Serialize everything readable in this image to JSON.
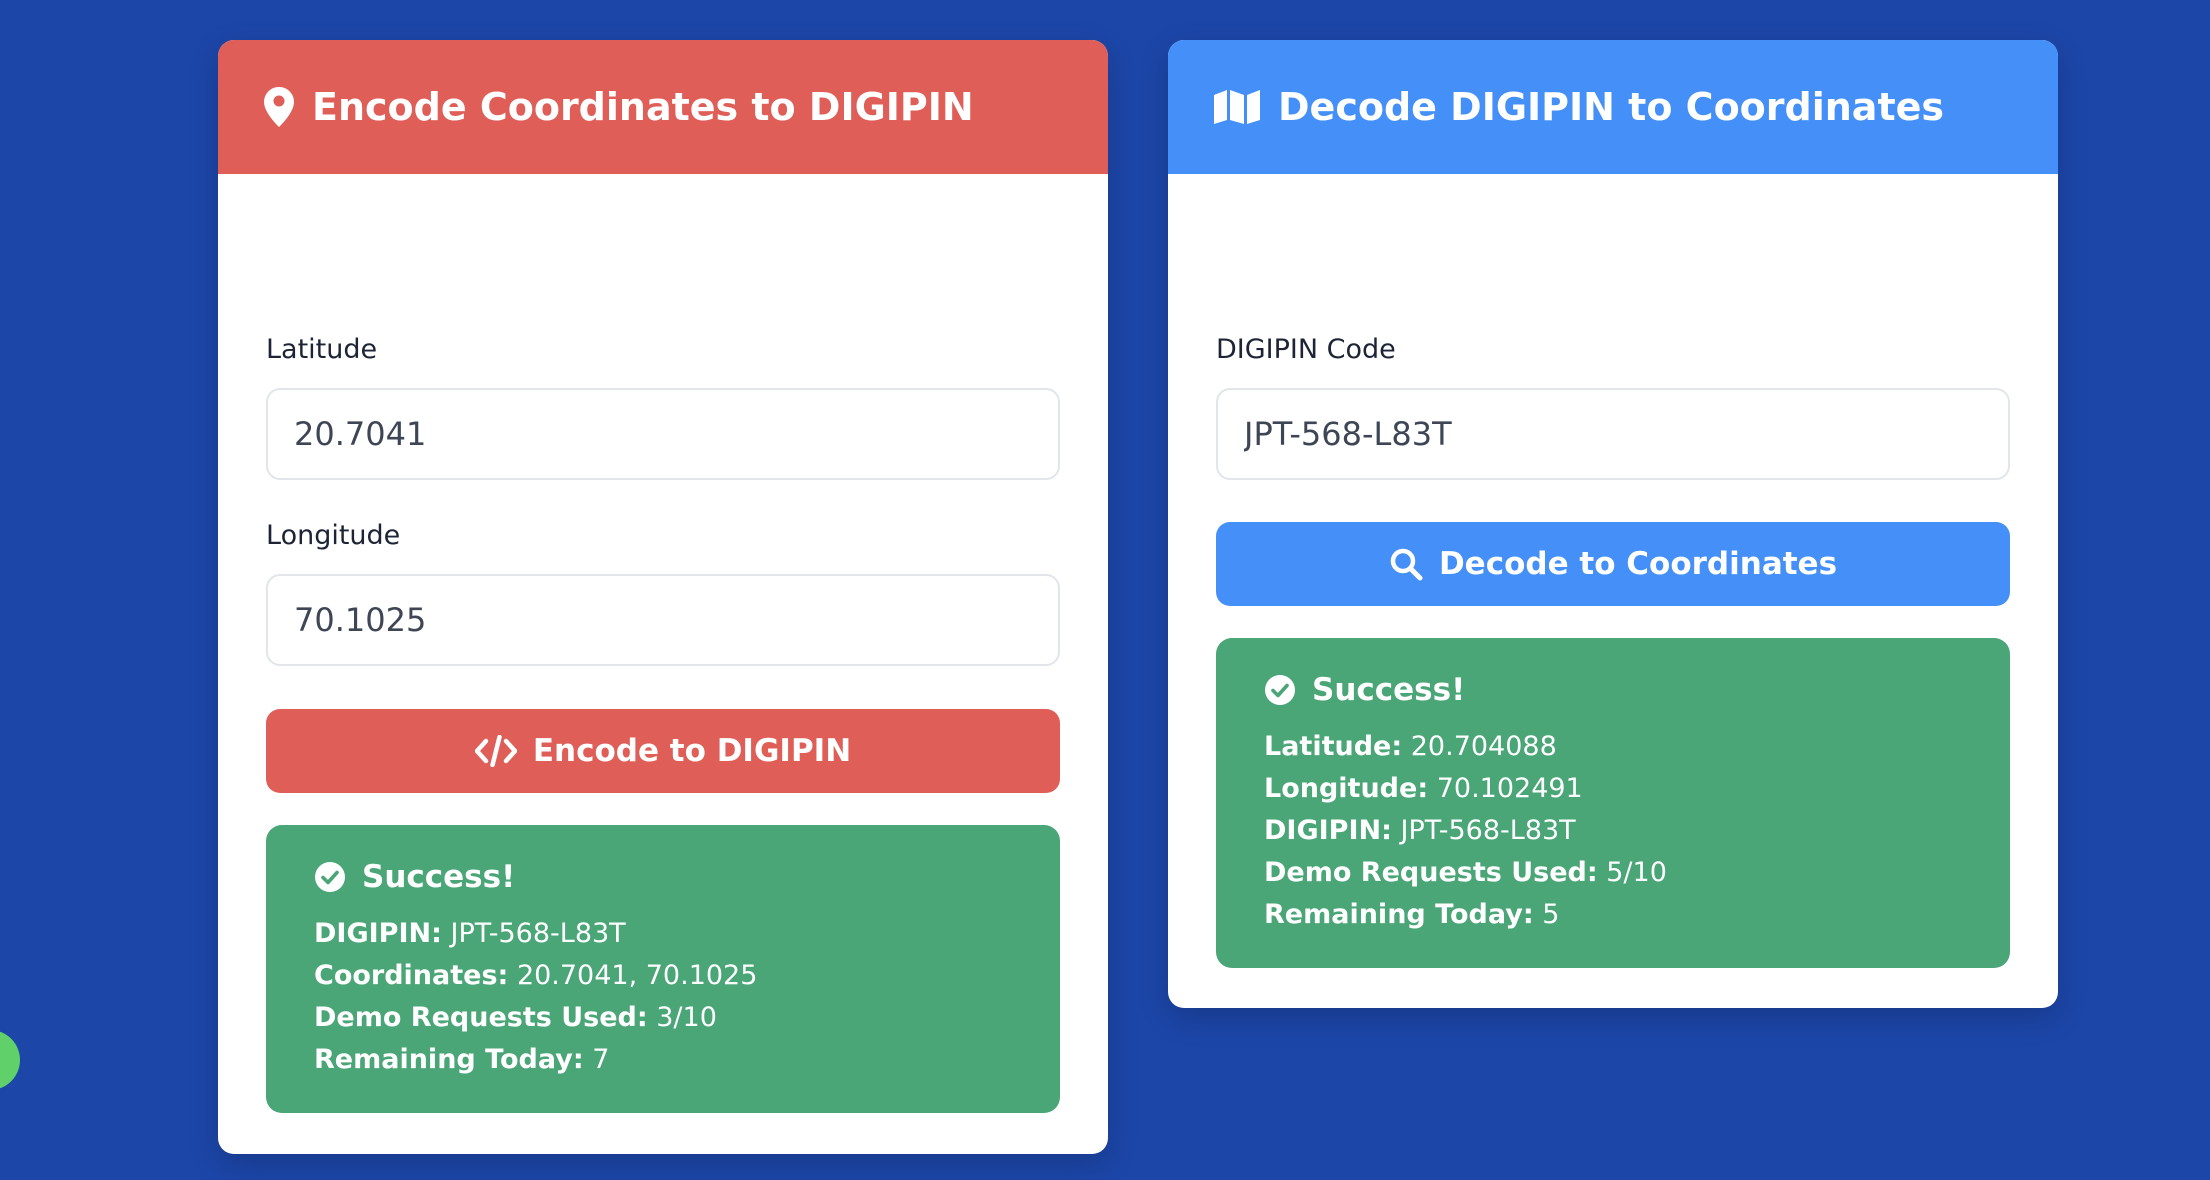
{
  "encode": {
    "title": "Encode Coordinates to DIGIPIN",
    "latitude_label": "Latitude",
    "latitude_value": "20.7041",
    "longitude_label": "Longitude",
    "longitude_value": "70.1025",
    "button_label": "Encode to DIGIPIN",
    "result": {
      "title": "Success!",
      "digipin_key": "DIGIPIN:",
      "digipin_value": "JPT-568-L83T",
      "coordinates_key": "Coordinates:",
      "coordinates_value": "20.7041, 70.1025",
      "requests_key": "Demo Requests Used:",
      "requests_value": "3/10",
      "remaining_key": "Remaining Today:",
      "remaining_value": "7"
    }
  },
  "decode": {
    "title": "Decode DIGIPIN to Coordinates",
    "code_label": "DIGIPIN Code",
    "code_value": "JPT-568-L83T",
    "button_label": "Decode to Coordinates",
    "result": {
      "title": "Success!",
      "latitude_key": "Latitude:",
      "latitude_value": "20.704088",
      "longitude_key": "Longitude:",
      "longitude_value": "70.102491",
      "digipin_key": "DIGIPIN:",
      "digipin_value": "JPT-568-L83T",
      "requests_key": "Demo Requests Used:",
      "requests_value": "5/10",
      "remaining_key": "Remaining Today:",
      "remaining_value": "5"
    }
  },
  "icons": {
    "encode_header": "map-marker-icon",
    "decode_header": "map-icon",
    "encode_button": "code-icon",
    "decode_button": "search-icon",
    "success": "check-circle-icon"
  },
  "colors": {
    "background": "#1c46a8",
    "encode_accent": "#df5f58",
    "decode_accent": "#4490f8",
    "success": "#4aa577"
  }
}
